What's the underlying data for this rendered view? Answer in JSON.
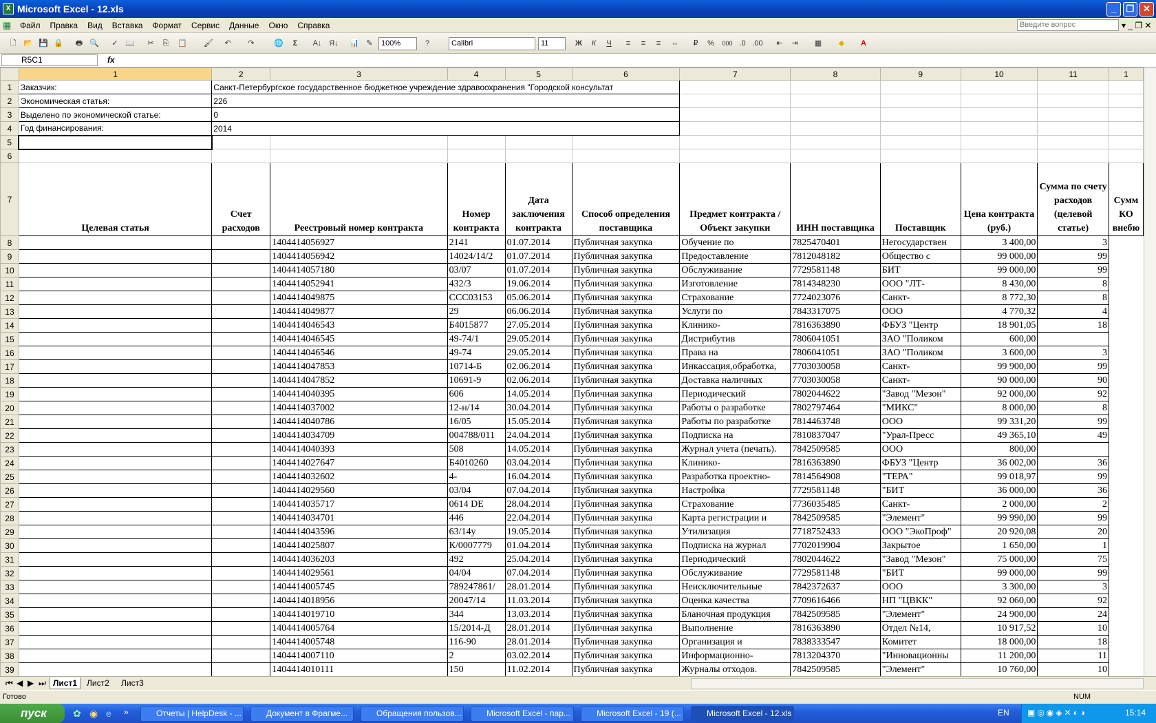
{
  "window": {
    "title": "Microsoft Excel - 12.xls"
  },
  "menu": [
    "Файл",
    "Правка",
    "Вид",
    "Вставка",
    "Формат",
    "Сервис",
    "Данные",
    "Окно",
    "Справка"
  ],
  "help_placeholder": "Введите вопрос",
  "toolbar": {
    "zoom": "100%",
    "font": "Calibri",
    "size": "11",
    "bold": "Ж",
    "italic": "К",
    "underline": "Ч",
    "percent": "%",
    "thousands": "000"
  },
  "namebox": "R5C1",
  "fx": "fx",
  "col_headers": [
    "1",
    "2",
    "3",
    "4",
    "5",
    "6",
    "7",
    "8",
    "9",
    "10",
    "11",
    "1"
  ],
  "meta_rows": [
    {
      "label": "Заказчик:",
      "value": "Санкт-Петербургское государственное бюджетное учреждение здравоохранения \"Городской консультат"
    },
    {
      "label": "Экономическая статья:",
      "value": "226"
    },
    {
      "label": "Выделено по экономической статье:",
      "value": "0"
    },
    {
      "label": "Год финансирования:",
      "value": "2014"
    }
  ],
  "headers": [
    "Целевая статья",
    "Счет расходов",
    "Реестровый номер контракта",
    "Номер контракта",
    "Дата заключения контракта",
    "Способ определения поставщика",
    "Предмет контракта / Объект закупки",
    "ИНН поставщика",
    "Поставщик",
    "Цена контракта (руб.)",
    "Сумма по счету расходов (целевой статье)",
    "Сумм КО внебю"
  ],
  "rows": [
    [
      "1404414056927",
      "2141",
      "01.07.2014",
      "Публичная закупка",
      "Обучение по",
      "7825470401",
      "Негосударствен",
      "3 400,00",
      "3"
    ],
    [
      "1404414056942",
      "14024/14/2",
      "01.07.2014",
      "Публичная закупка",
      "Предоставление",
      "7812048182",
      "Общество с",
      "99 000,00",
      "99"
    ],
    [
      "1404414057180",
      "03/07",
      "01.07.2014",
      "Публичная закупка",
      "Обслуживание",
      "7729581148",
      "БИТ",
      "99 000,00",
      "99"
    ],
    [
      "1404414052941",
      "432/3",
      "19.06.2014",
      "Публичная закупка",
      "Изготовление",
      "7814348230",
      "ООО \"ЛТ-",
      "8 430,00",
      "8"
    ],
    [
      "1404414049875",
      "ССС03153",
      "05.06.2014",
      "Публичная закупка",
      "Страхование",
      "7724023076",
      "Санкт-",
      "8 772,30",
      "8"
    ],
    [
      "1404414049877",
      "29",
      "06.06.2014",
      "Публичная закупка",
      "Услуги по",
      "7843317075",
      "ООО",
      "4 770,32",
      "4"
    ],
    [
      "1404414046543",
      "Б4015877",
      "27.05.2014",
      "Публичная закупка",
      "Клинико-",
      "7816363890",
      " ФБУЗ \"Центр",
      "18 901,05",
      "18"
    ],
    [
      "1404414046545",
      "49-74/1",
      "29.05.2014",
      "Публичная закупка",
      "Дистрибутив",
      "7806041051",
      "ЗАО \"Поликом",
      "600,00",
      ""
    ],
    [
      "1404414046546",
      "49-74",
      "29.05.2014",
      "Публичная закупка",
      "Права на",
      "7806041051",
      "ЗАО \"Поликом",
      "3 600,00",
      "3"
    ],
    [
      "1404414047853",
      "10714-Б",
      "02.06.2014",
      "Публичная закупка",
      "Инкассация,обработка,",
      "7703030058",
      "Санкт-",
      "99 900,00",
      "99"
    ],
    [
      "1404414047852",
      "10691-9",
      "02.06.2014",
      "Публичная закупка",
      "Доставка наличных",
      "7703030058",
      "Санкт-",
      "90 000,00",
      "90"
    ],
    [
      "1404414040395",
      "606",
      "14.05.2014",
      "Публичная закупка",
      "Периодический",
      "7802044622",
      "\"Завод \"Мезон\"",
      "92 000,00",
      "92"
    ],
    [
      "1404414037002",
      "12-н/14",
      "30.04.2014",
      "Публичная закупка",
      "Работы о разработке",
      "7802797464",
      "\"МИКС\"",
      "8 000,00",
      "8"
    ],
    [
      "1404414040786",
      "16/05",
      "15.05.2014",
      "Публичная закупка",
      "Работы по разработке",
      "7814463748",
      "ООО",
      "99 331,20",
      "99"
    ],
    [
      "1404414034709",
      "004788/011",
      "24.04.2014",
      "Публичная закупка",
      "Подписка на",
      "7810837047",
      " \"Урал-Пресс",
      "49 365,10",
      "49"
    ],
    [
      "1404414040393",
      "508",
      "14.05.2014",
      "Публичная закупка",
      "Журнал учета (печать).",
      "7842509585",
      "ООО",
      "800,00",
      ""
    ],
    [
      "1404414027647",
      "Б4010260",
      "03.04.2014",
      "Публичная закупка",
      "Клинико-",
      "7816363890",
      " ФБУЗ \"Центр",
      "36 002,00",
      "36"
    ],
    [
      "1404414032602",
      "4-",
      "16.04.2014",
      "Публичная закупка",
      "Разработка проектно-",
      "7814564908",
      "\"ТЕРА\"",
      "99 018,97",
      "99"
    ],
    [
      "1404414029560",
      "03/04",
      "07.04.2014",
      "Публичная закупка",
      "Настройка",
      "7729581148",
      "\"БИТ",
      "36 000,00",
      "36"
    ],
    [
      "1404414035717",
      "0614 DE",
      "28.04.2014",
      "Публичная закупка",
      "Страхование",
      "7736035485",
      "Санкт-",
      "2 000,00",
      "2"
    ],
    [
      "1404414034701",
      "446",
      "22.04.2014",
      "Публичная закупка",
      "Карта регистрации и",
      "7842509585",
      "\"Элемент\"",
      "99 990,00",
      "99"
    ],
    [
      "1404414043596",
      "63/14у",
      "19.05.2014",
      "Публичная закупка",
      "Утилизация",
      "7718752433",
      "ООО \"ЭкоПроф\"",
      "20 920,08",
      "20"
    ],
    [
      "1404414025807",
      "К/0007779",
      "01.04.2014",
      "Публичная закупка",
      "Подписка на журнал",
      "7702019904",
      "Закрытое",
      "1 650,00",
      "1"
    ],
    [
      "1404414036203",
      "492",
      "25.04.2014",
      "Публичная закупка",
      "Периодический",
      "7802044622",
      "\"Завод \"Мезон\"",
      "75 000,00",
      "75"
    ],
    [
      "1404414029561",
      "04/04",
      "07.04.2014",
      "Публичная закупка",
      "Обслуживание",
      "7729581148",
      "\"БИТ",
      "99 000,00",
      "99"
    ],
    [
      "1404414005745",
      "789247861/",
      "28.01.2014",
      "Публичная закупка",
      "Неисключительные",
      "7842372637",
      "ООО",
      "3 300,00",
      "3"
    ],
    [
      "1404414018956",
      "20047/14",
      "11.03.2014",
      "Публичная закупка",
      "Оценка качества",
      "7709616466",
      "НП \"ЦВКК\"",
      "92 060,00",
      "92"
    ],
    [
      "1404414019710",
      "344",
      "13.03.2014",
      "Публичная закупка",
      "Бланочная продукция",
      "7842509585",
      "\"Элемент\"",
      "24 900,00",
      "24"
    ],
    [
      "1404414005764",
      "15/2014-Д",
      "28.01.2014",
      "Публичная закупка",
      "Выполнение",
      "7816363890",
      "Отдел №14,",
      "10 917,52",
      "10"
    ],
    [
      "1404414005748",
      "116-90",
      "28.01.2014",
      "Публичная закупка",
      "Организация и",
      "7838333547",
      "Комитет",
      "18 000,00",
      "18"
    ],
    [
      "1404414007110",
      "2",
      "03.02.2014",
      "Публичная закупка",
      "Информационно-",
      "7813204370",
      "\"Инновационны",
      "11 200,00",
      "11"
    ],
    [
      "1404414010111",
      "150",
      "11.02.2014",
      "Публичная закупка",
      "Журналы отходов.",
      "7842509585",
      "\"Элемент\"",
      "10 760,00",
      "10"
    ]
  ],
  "sheets": [
    "Лист1",
    "Лист2",
    "Лист3"
  ],
  "status": {
    "left": "Готово",
    "num": "NUM"
  },
  "taskbar": {
    "start": "пуск",
    "tasks": [
      "Отчеты | HelpDesk - ...",
      "Документ в Фрагме...",
      "Обращения пользов...",
      "Microsoft Excel - пар...",
      "Microsoft Excel - 19 (...",
      "Microsoft Excel - 12.xls"
    ],
    "lang": "EN",
    "clock": "15:14"
  }
}
